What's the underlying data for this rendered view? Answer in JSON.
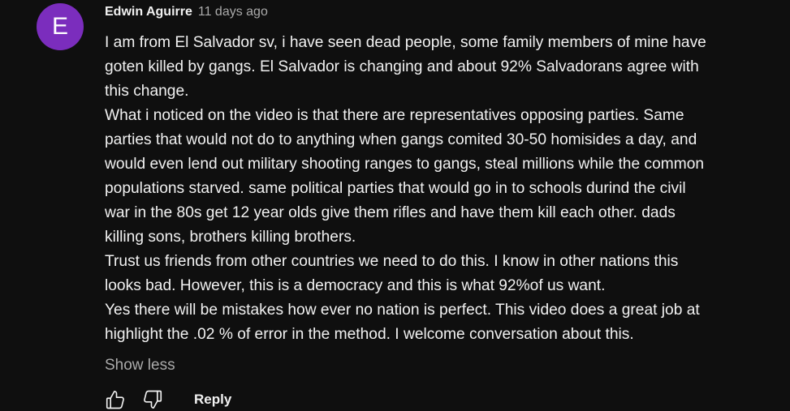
{
  "comment": {
    "avatar_letter": "E",
    "avatar_color": "#7b2dbd",
    "author": "Edwin Aguirre",
    "time": "11 days ago",
    "text": "I am from El Salvador sv, i have seen dead people, some family members of mine have\ngoten killed by gangs. El Salvador is changing and about 92% Salvadorans agree with\nthis change.\nWhat i noticed on the video is that there are representatives opposing parties. Same\nparties that would not do to anything when gangs comited 30-50 homisides a day, and\nwould even lend out military shooting ranges to gangs, steal millions while the common\npopulations starved.  same political parties that would go in to schools durind the civil\nwar in the 80s get 12 year olds give them rifles and have them  kill each other. dads\nkilling sons, brothers killing brothers.\n Trust us friends from other countries  we need to do this. I know in other nations this\nlooks bad. However, this is a democracy and this is what 92%of us want.\nYes there will be mistakes how ever no nation is perfect. This video does a great job at\nhighlight the .02 % of error in the method. I welcome conversation about this.",
    "show_less_label": "Show less"
  },
  "actions": {
    "like_icon": "thumbs-up-icon",
    "dislike_icon": "thumbs-down-icon",
    "reply_label": "Reply"
  }
}
